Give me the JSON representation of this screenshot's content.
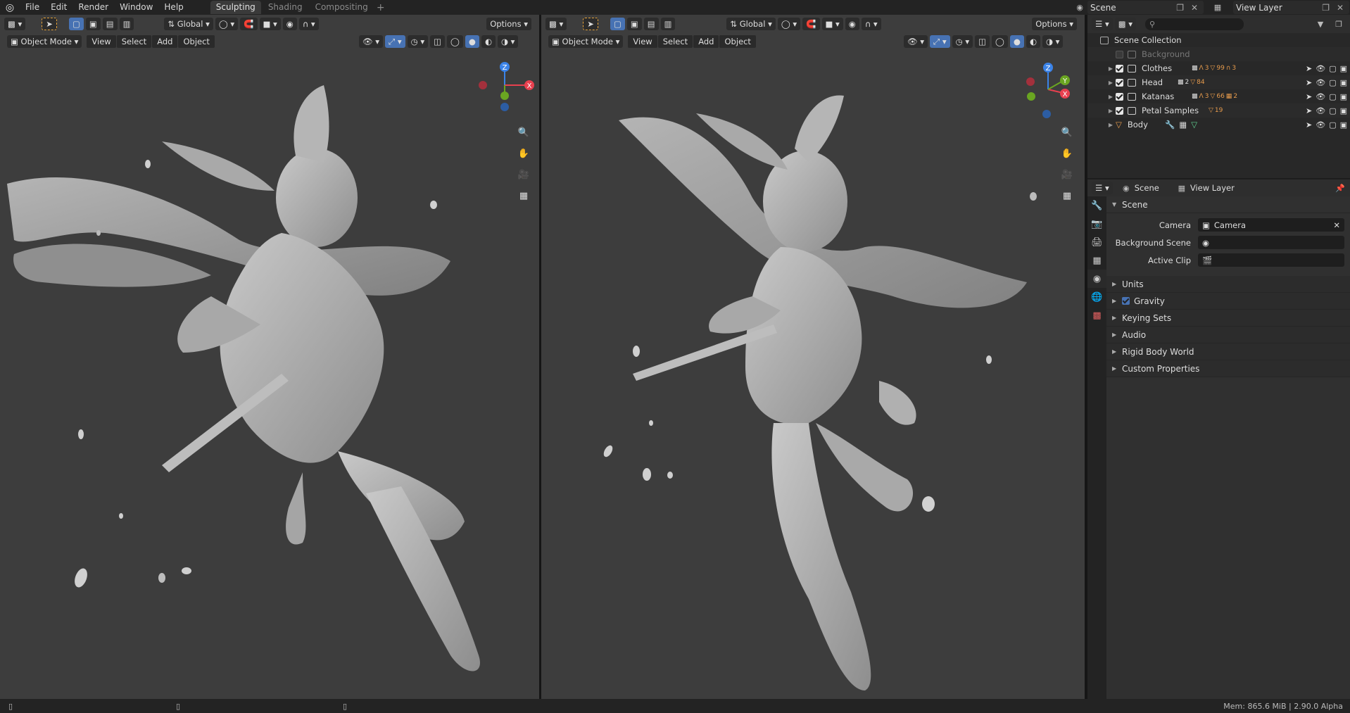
{
  "menu": {
    "file": "File",
    "edit": "Edit",
    "render": "Render",
    "window": "Window",
    "help": "Help"
  },
  "workspaces": [
    {
      "label": "Sculpting",
      "active": true
    },
    {
      "label": "Shading",
      "active": false
    },
    {
      "label": "Compositing",
      "active": false
    }
  ],
  "scene_selector": "Scene",
  "viewlayer_selector": "View Layer",
  "viewport_left": {
    "transform_orientation": "Global",
    "options": "Options",
    "mode": "Object Mode",
    "menus": [
      "View",
      "Select",
      "Add",
      "Object"
    ],
    "axes": {
      "x": "X",
      "y": "Y",
      "z": "Z"
    }
  },
  "viewport_right": {
    "transform_orientation": "Global",
    "options": "Options",
    "mode": "Object Mode",
    "menus": [
      "View",
      "Select",
      "Add",
      "Object"
    ],
    "axes": {
      "x": "X",
      "y": "Y",
      "z": "Z"
    }
  },
  "outliner": {
    "root": "Scene Collection",
    "items": [
      {
        "label": "Background",
        "checked": false,
        "badges": []
      },
      {
        "label": "Clothes",
        "checked": true,
        "badges": [
          "3",
          "99",
          "3"
        ]
      },
      {
        "label": "Head",
        "checked": true,
        "badges": [
          "2",
          "84"
        ]
      },
      {
        "label": "Katanas",
        "checked": true,
        "badges": [
          "3",
          "66",
          "2"
        ]
      },
      {
        "label": "Petal Samples",
        "checked": true,
        "badges": [
          "19"
        ]
      },
      {
        "label": "Body",
        "checked": true,
        "badges": []
      }
    ]
  },
  "properties": {
    "breadcrumb_scene": "Scene",
    "breadcrumb_viewlayer": "View Layer",
    "panel_title": "Scene",
    "camera_label": "Camera",
    "camera_value": "Camera",
    "background_scene_label": "Background Scene",
    "active_clip_label": "Active Clip",
    "subpanels": [
      "Units",
      "Gravity",
      "Keying Sets",
      "Audio",
      "Rigid Body World",
      "Custom Properties"
    ]
  },
  "status": {
    "memory": "Mem: 865.6 MiB | 2.90.0 Alpha"
  },
  "colors": {
    "accent": "#4772b3",
    "axis_x": "#e8404f",
    "axis_y": "#6aa521",
    "axis_z": "#3b83e8",
    "orange": "#e59a4c"
  }
}
